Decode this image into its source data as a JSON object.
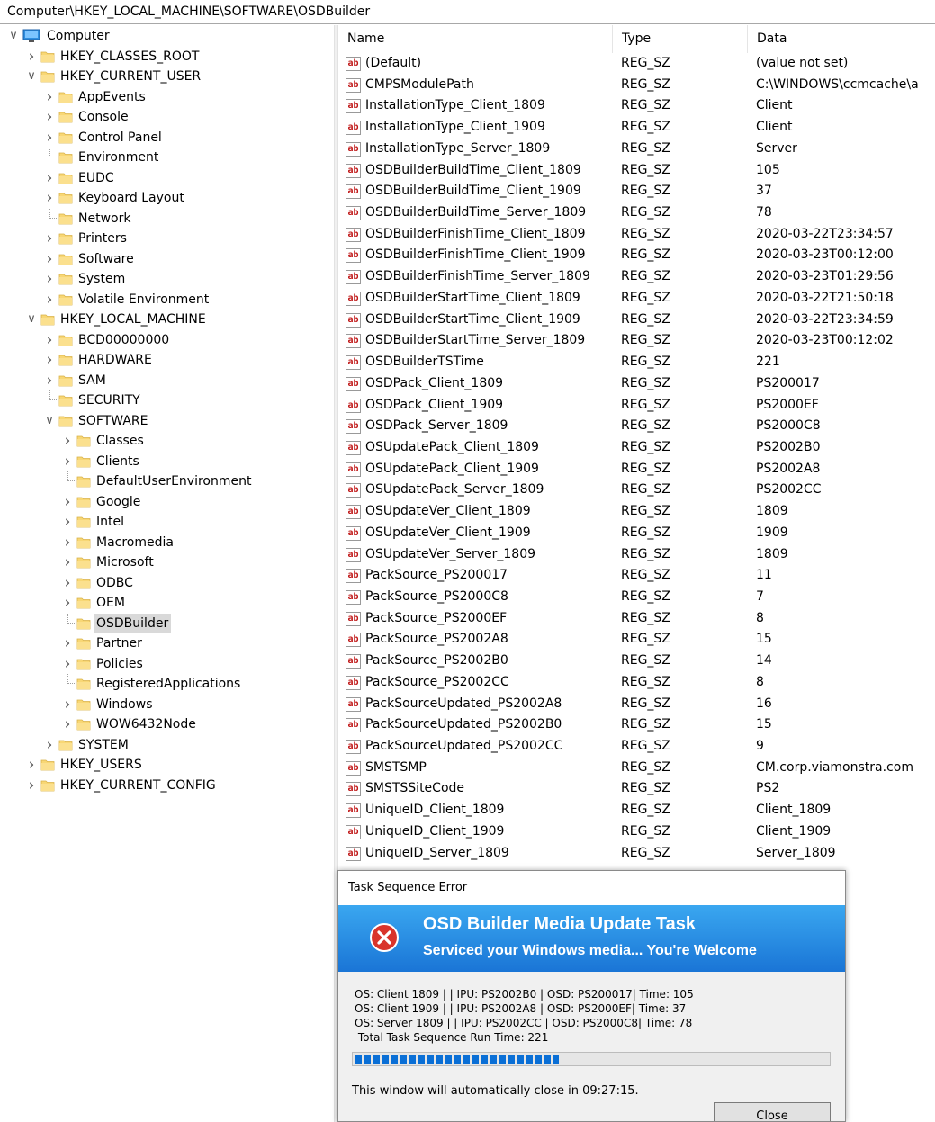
{
  "address": "Computer\\HKEY_LOCAL_MACHINE\\SOFTWARE\\OSDBuilder",
  "tree": [
    {
      "label": "Computer",
      "level": 0,
      "chev": "expanded",
      "icon": "computer-icon",
      "dot": false
    },
    {
      "label": "HKEY_CLASSES_ROOT",
      "level": 1,
      "chev": "collapsed",
      "icon": "folder-icon",
      "dot": false
    },
    {
      "label": "HKEY_CURRENT_USER",
      "level": 1,
      "chev": "expanded",
      "icon": "folder-icon",
      "dot": false
    },
    {
      "label": "AppEvents",
      "level": 2,
      "chev": "collapsed",
      "icon": "folder-icon",
      "dot": false
    },
    {
      "label": "Console",
      "level": 2,
      "chev": "collapsed",
      "icon": "folder-icon",
      "dot": false
    },
    {
      "label": "Control Panel",
      "level": 2,
      "chev": "collapsed",
      "icon": "folder-icon",
      "dot": false
    },
    {
      "label": "Environment",
      "level": 2,
      "chev": "none",
      "icon": "folder-icon",
      "dot": true
    },
    {
      "label": "EUDC",
      "level": 2,
      "chev": "collapsed",
      "icon": "folder-icon",
      "dot": false
    },
    {
      "label": "Keyboard Layout",
      "level": 2,
      "chev": "collapsed",
      "icon": "folder-icon",
      "dot": false
    },
    {
      "label": "Network",
      "level": 2,
      "chev": "none",
      "icon": "folder-icon",
      "dot": true
    },
    {
      "label": "Printers",
      "level": 2,
      "chev": "collapsed",
      "icon": "folder-icon",
      "dot": false
    },
    {
      "label": "Software",
      "level": 2,
      "chev": "collapsed",
      "icon": "folder-icon",
      "dot": false
    },
    {
      "label": "System",
      "level": 2,
      "chev": "collapsed",
      "icon": "folder-icon",
      "dot": false
    },
    {
      "label": "Volatile Environment",
      "level": 2,
      "chev": "collapsed",
      "icon": "folder-icon",
      "dot": false
    },
    {
      "label": "HKEY_LOCAL_MACHINE",
      "level": 1,
      "chev": "expanded",
      "icon": "folder-icon",
      "dot": false
    },
    {
      "label": "BCD00000000",
      "level": 2,
      "chev": "collapsed",
      "icon": "folder-icon",
      "dot": false
    },
    {
      "label": "HARDWARE",
      "level": 2,
      "chev": "collapsed",
      "icon": "folder-icon",
      "dot": false
    },
    {
      "label": "SAM",
      "level": 2,
      "chev": "collapsed",
      "icon": "folder-icon",
      "dot": false
    },
    {
      "label": "SECURITY",
      "level": 2,
      "chev": "none",
      "icon": "folder-icon",
      "dot": true
    },
    {
      "label": "SOFTWARE",
      "level": 2,
      "chev": "expanded",
      "icon": "folder-icon",
      "dot": false
    },
    {
      "label": "Classes",
      "level": 3,
      "chev": "collapsed",
      "icon": "folder-icon",
      "dot": false
    },
    {
      "label": "Clients",
      "level": 3,
      "chev": "collapsed",
      "icon": "folder-icon",
      "dot": false
    },
    {
      "label": "DefaultUserEnvironment",
      "level": 3,
      "chev": "none",
      "icon": "folder-icon",
      "dot": true
    },
    {
      "label": "Google",
      "level": 3,
      "chev": "collapsed",
      "icon": "folder-icon",
      "dot": false
    },
    {
      "label": "Intel",
      "level": 3,
      "chev": "collapsed",
      "icon": "folder-icon",
      "dot": false
    },
    {
      "label": "Macromedia",
      "level": 3,
      "chev": "collapsed",
      "icon": "folder-icon",
      "dot": false
    },
    {
      "label": "Microsoft",
      "level": 3,
      "chev": "collapsed",
      "icon": "folder-icon",
      "dot": false
    },
    {
      "label": "ODBC",
      "level": 3,
      "chev": "collapsed",
      "icon": "folder-icon",
      "dot": false
    },
    {
      "label": "OEM",
      "level": 3,
      "chev": "collapsed",
      "icon": "folder-icon",
      "dot": false
    },
    {
      "label": "OSDBuilder",
      "level": 3,
      "chev": "none",
      "icon": "folder-icon",
      "dot": true,
      "selected": true
    },
    {
      "label": "Partner",
      "level": 3,
      "chev": "collapsed",
      "icon": "folder-icon",
      "dot": false
    },
    {
      "label": "Policies",
      "level": 3,
      "chev": "collapsed",
      "icon": "folder-icon",
      "dot": false
    },
    {
      "label": "RegisteredApplications",
      "level": 3,
      "chev": "none",
      "icon": "folder-icon",
      "dot": true
    },
    {
      "label": "Windows",
      "level": 3,
      "chev": "collapsed",
      "icon": "folder-icon",
      "dot": false
    },
    {
      "label": "WOW6432Node",
      "level": 3,
      "chev": "collapsed",
      "icon": "folder-icon",
      "dot": false
    },
    {
      "label": "SYSTEM",
      "level": 2,
      "chev": "collapsed",
      "icon": "folder-icon",
      "dot": false
    },
    {
      "label": "HKEY_USERS",
      "level": 1,
      "chev": "collapsed",
      "icon": "folder-icon",
      "dot": false
    },
    {
      "label": "HKEY_CURRENT_CONFIG",
      "level": 1,
      "chev": "collapsed",
      "icon": "folder-icon",
      "dot": false
    }
  ],
  "columns": {
    "name": "Name",
    "type": "Type",
    "data": "Data"
  },
  "values": [
    {
      "name": "(Default)",
      "type": "REG_SZ",
      "data": "(value not set)"
    },
    {
      "name": "CMPSModulePath",
      "type": "REG_SZ",
      "data": "C:\\WINDOWS\\ccmcache\\a"
    },
    {
      "name": "InstallationType_Client_1809",
      "type": "REG_SZ",
      "data": "Client"
    },
    {
      "name": "InstallationType_Client_1909",
      "type": "REG_SZ",
      "data": "Client"
    },
    {
      "name": "InstallationType_Server_1809",
      "type": "REG_SZ",
      "data": "Server"
    },
    {
      "name": "OSDBuilderBuildTime_Client_1809",
      "type": "REG_SZ",
      "data": "105"
    },
    {
      "name": "OSDBuilderBuildTime_Client_1909",
      "type": "REG_SZ",
      "data": "37"
    },
    {
      "name": "OSDBuilderBuildTime_Server_1809",
      "type": "REG_SZ",
      "data": "78"
    },
    {
      "name": "OSDBuilderFinishTime_Client_1809",
      "type": "REG_SZ",
      "data": "2020-03-22T23:34:57"
    },
    {
      "name": "OSDBuilderFinishTime_Client_1909",
      "type": "REG_SZ",
      "data": "2020-03-23T00:12:00"
    },
    {
      "name": "OSDBuilderFinishTime_Server_1809",
      "type": "REG_SZ",
      "data": "2020-03-23T01:29:56"
    },
    {
      "name": "OSDBuilderStartTime_Client_1809",
      "type": "REG_SZ",
      "data": "2020-03-22T21:50:18"
    },
    {
      "name": "OSDBuilderStartTime_Client_1909",
      "type": "REG_SZ",
      "data": "2020-03-22T23:34:59"
    },
    {
      "name": "OSDBuilderStartTime_Server_1809",
      "type": "REG_SZ",
      "data": "2020-03-23T00:12:02"
    },
    {
      "name": "OSDBuilderTSTime",
      "type": "REG_SZ",
      "data": "221"
    },
    {
      "name": "OSDPack_Client_1809",
      "type": "REG_SZ",
      "data": "PS200017"
    },
    {
      "name": "OSDPack_Client_1909",
      "type": "REG_SZ",
      "data": "PS2000EF"
    },
    {
      "name": "OSDPack_Server_1809",
      "type": "REG_SZ",
      "data": "PS2000C8"
    },
    {
      "name": "OSUpdatePack_Client_1809",
      "type": "REG_SZ",
      "data": "PS2002B0"
    },
    {
      "name": "OSUpdatePack_Client_1909",
      "type": "REG_SZ",
      "data": "PS2002A8"
    },
    {
      "name": "OSUpdatePack_Server_1809",
      "type": "REG_SZ",
      "data": "PS2002CC"
    },
    {
      "name": "OSUpdateVer_Client_1809",
      "type": "REG_SZ",
      "data": "1809"
    },
    {
      "name": "OSUpdateVer_Client_1909",
      "type": "REG_SZ",
      "data": "1909"
    },
    {
      "name": "OSUpdateVer_Server_1809",
      "type": "REG_SZ",
      "data": "1809"
    },
    {
      "name": "PackSource_PS200017",
      "type": "REG_SZ",
      "data": "11"
    },
    {
      "name": "PackSource_PS2000C8",
      "type": "REG_SZ",
      "data": "7"
    },
    {
      "name": "PackSource_PS2000EF",
      "type": "REG_SZ",
      "data": "8"
    },
    {
      "name": "PackSource_PS2002A8",
      "type": "REG_SZ",
      "data": "15"
    },
    {
      "name": "PackSource_PS2002B0",
      "type": "REG_SZ",
      "data": "14"
    },
    {
      "name": "PackSource_PS2002CC",
      "type": "REG_SZ",
      "data": "8"
    },
    {
      "name": "PackSourceUpdated_PS2002A8",
      "type": "REG_SZ",
      "data": "16"
    },
    {
      "name": "PackSourceUpdated_PS2002B0",
      "type": "REG_SZ",
      "data": "15"
    },
    {
      "name": "PackSourceUpdated_PS2002CC",
      "type": "REG_SZ",
      "data": "9"
    },
    {
      "name": "SMSTSMP",
      "type": "REG_SZ",
      "data": "CM.corp.viamonstra.com"
    },
    {
      "name": "SMSTSSiteCode",
      "type": "REG_SZ",
      "data": "PS2"
    },
    {
      "name": "UniqueID_Client_1809",
      "type": "REG_SZ",
      "data": "Client_1809"
    },
    {
      "name": "UniqueID_Client_1909",
      "type": "REG_SZ",
      "data": "Client_1909"
    },
    {
      "name": "UniqueID_Server_1809",
      "type": "REG_SZ",
      "data": "Server_1809"
    }
  ],
  "value_icon": "ab",
  "dialog": {
    "title": "Task Sequence Error",
    "banner_title": "OSD Builder Media Update Task",
    "banner_subtitle": "Serviced your Windows media... You're Welcome",
    "lines": [
      "OS: Client 1809 |   | IPU: PS2002B0 | OSD: PS200017| Time: 105",
      "OS: Client 1909 |   | IPU: PS2002A8 | OSD: PS2000EF| Time: 37",
      "OS: Server 1809 |   | IPU: PS2002CC | OSD: PS2000C8| Time: 78",
      " Total Task Sequence Run Time: 221"
    ],
    "progress_fraction": 0.43,
    "countdown": "This window will automatically close in 09:27:15.",
    "close_label": "Close"
  },
  "colors": {
    "banner_top": "#3aa7f0",
    "banner_bottom": "#1a75d6",
    "progress": "#0a6fd6",
    "folder": "#f8d775",
    "selection": "#d9d9d9",
    "error": "#d9342b"
  }
}
